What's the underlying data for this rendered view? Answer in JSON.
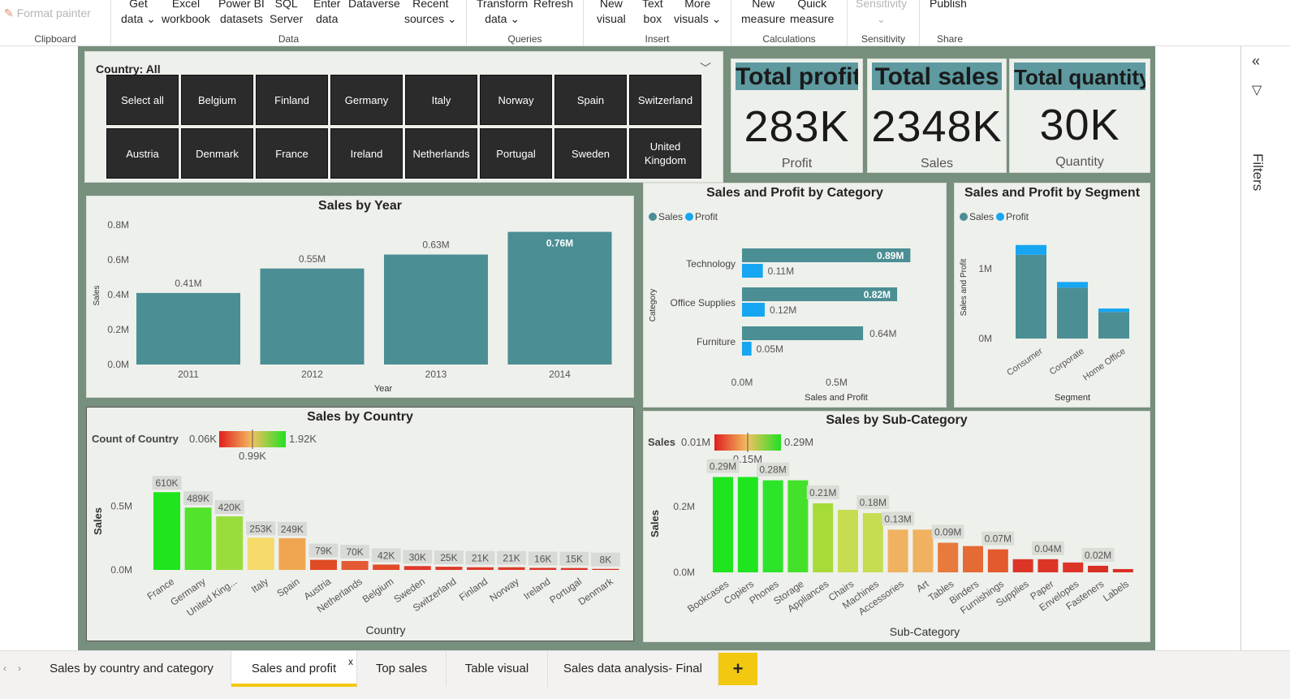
{
  "ribbon": {
    "format_painter": "Format painter",
    "groups": {
      "clipboard": "Clipboard",
      "data": "Data",
      "queries": "Queries",
      "insert": "Insert",
      "calculations": "Calculations",
      "sensitivity": "Sensitivity",
      "share": "Share"
    },
    "buttons": {
      "get_data_1": "Get",
      "get_data_2": "data",
      "excel_1": "Excel",
      "excel_2": "workbook",
      "pbi_1": "Power BI",
      "pbi_2": "datasets",
      "sql_1": "SQL",
      "sql_2": "Server",
      "enter_1": "Enter",
      "enter_2": "data",
      "dataverse_1": "Dataverse",
      "recent_1": "Recent",
      "recent_2": "sources",
      "transform_1": "Transform",
      "transform_2": "data",
      "refresh_1": "Refresh",
      "new_visual_1": "New",
      "new_visual_2": "visual",
      "text_box_1": "Text",
      "text_box_2": "box",
      "more_visuals_1": "More",
      "more_visuals_2": "visuals",
      "new_measure_1": "New",
      "new_measure_2": "measure",
      "quick_measure_1": "Quick",
      "quick_measure_2": "measure",
      "sensitivity_1": "Sensitivity",
      "publish_1": "Publish"
    }
  },
  "slicer": {
    "header": "Country: All",
    "buttons": [
      "Select all",
      "Belgium",
      "Finland",
      "Germany",
      "Italy",
      "Norway",
      "Spain",
      "Switzerland",
      "Austria",
      "Denmark",
      "France",
      "Ireland",
      "Netherlands",
      "Portugal",
      "Sweden",
      "United Kingdom"
    ]
  },
  "cards": [
    {
      "title": "Total profit",
      "value": "283K",
      "label": "Profit"
    },
    {
      "title": "Total sales",
      "value": "2348K",
      "label": "Sales"
    },
    {
      "title": "Total quantity",
      "value": "30K",
      "label": "Quantity"
    }
  ],
  "colors": {
    "teal": "#4b8e94",
    "profit_blue": "#16a6f2",
    "report_bg": "#778f7d",
    "panel_bg": "#eef0ec",
    "accent": "#f2c811"
  },
  "charts": {
    "sales_by_year": {
      "title": "Sales by Year",
      "chart_data": {
        "type": "bar",
        "categories": [
          "2011",
          "2012",
          "2013",
          "2014"
        ],
        "values": [
          0.41,
          0.55,
          0.63,
          0.76
        ],
        "data_labels": [
          "0.41M",
          "0.55M",
          "0.63M",
          "0.76M"
        ],
        "yticks": [
          "0.0M",
          "0.2M",
          "0.4M",
          "0.6M",
          "0.8M"
        ],
        "ylim": [
          0,
          0.8
        ],
        "xlabel": "Year",
        "ylabel": "Sales"
      }
    },
    "sales_profit_category": {
      "title": "Sales and Profit by Category",
      "legend": [
        "Sales",
        "Profit"
      ],
      "chart_data": {
        "type": "bar",
        "orientation": "horizontal",
        "categories": [
          "Technology",
          "Office Supplies",
          "Furniture"
        ],
        "series": [
          {
            "name": "Sales",
            "values": [
              0.89,
              0.82,
              0.64
            ],
            "labels": [
              "0.89M",
              "0.82M",
              "0.64M"
            ]
          },
          {
            "name": "Profit",
            "values": [
              0.11,
              0.12,
              0.05
            ],
            "labels": [
              "0.11M",
              "0.12M",
              "0.05M"
            ]
          }
        ],
        "xticks": [
          "0.0M",
          "0.5M"
        ],
        "xlim": [
          0,
          1.0
        ],
        "xlabel": "Sales and Profit",
        "ylabel": "Category"
      }
    },
    "sales_profit_segment": {
      "title": "Sales and Profit by Segment",
      "legend": [
        "Sales",
        "Profit"
      ],
      "chart_data": {
        "type": "bar",
        "stacked": true,
        "categories": [
          "Consumer",
          "Corporate",
          "Home Office"
        ],
        "series": [
          {
            "name": "Sales",
            "values": [
              1.2,
              0.73,
              0.38
            ]
          },
          {
            "name": "Profit",
            "values": [
              0.14,
              0.08,
              0.05
            ]
          }
        ],
        "yticks": [
          "0M",
          "1M"
        ],
        "ylim": [
          0,
          1.6
        ],
        "xlabel": "Segment",
        "ylabel": "Sales and Profit"
      }
    },
    "sales_by_country": {
      "title": "Sales by Country",
      "legend_title": "Count of Country",
      "legend_min": "0.06K",
      "legend_mid": "0.99K",
      "legend_max": "1.92K",
      "chart_data": {
        "type": "bar",
        "categories": [
          "France",
          "Germany",
          "United King...",
          "Italy",
          "Spain",
          "Austria",
          "Netherlands",
          "Belgium",
          "Sweden",
          "Switzerland",
          "Finland",
          "Norway",
          "Ireland",
          "Portugal",
          "Denmark"
        ],
        "values": [
          610,
          489,
          420,
          253,
          249,
          79,
          70,
          42,
          30,
          25,
          21,
          21,
          16,
          15,
          8
        ],
        "data_labels": [
          "610K",
          "489K",
          "420K",
          "253K",
          "249K",
          "79K",
          "70K",
          "42K",
          "30K",
          "25K",
          "21K",
          "21K",
          "16K",
          "15K",
          "8K"
        ],
        "bar_colors": [
          "#1ee51e",
          "#52e32c",
          "#99dd3c",
          "#f6da6a",
          "#f0a650",
          "#e04a24",
          "#e35a34",
          "#e24a28",
          "#e0392a",
          "#dd3a28",
          "#de3a2a",
          "#de3a2a",
          "#dd3528",
          "#dd3528",
          "#d93025"
        ],
        "yticks": [
          "0.0M",
          "0.5M"
        ],
        "ylim": [
          0,
          700
        ],
        "xlabel": "Country",
        "ylabel": "Sales"
      }
    },
    "sales_by_subcategory": {
      "title": "Sales by Sub-Category",
      "legend_title": "Sales",
      "legend_min": "0.01M",
      "legend_mid": "0.15M",
      "legend_max": "0.29M",
      "chart_data": {
        "type": "bar",
        "categories": [
          "Bookcases",
          "Copiers",
          "Phones",
          "Storage",
          "Appliances",
          "Chairs",
          "Machines",
          "Accessories",
          "Art",
          "Tables",
          "Binders",
          "Furnishings",
          "Supplies",
          "Paper",
          "Envelopes",
          "Fasteners",
          "Labels"
        ],
        "values": [
          0.29,
          0.29,
          0.28,
          0.28,
          0.21,
          0.19,
          0.18,
          0.13,
          0.13,
          0.09,
          0.08,
          0.07,
          0.04,
          0.04,
          0.03,
          0.02,
          0.01
        ],
        "data_labels": [
          "0.29M",
          "",
          "0.28M",
          "",
          "0.21M",
          "",
          "0.18M",
          "0.13M",
          "",
          "0.09M",
          "",
          "0.07M",
          "",
          "0.04M",
          "",
          "0.02M",
          ""
        ],
        "bar_colors": [
          "#1ee51e",
          "#1fe51f",
          "#2ce52a",
          "#44e12a",
          "#a6db38",
          "#c6dd52",
          "#c6dd52",
          "#f0b260",
          "#f0b260",
          "#e77a3c",
          "#e46b34",
          "#e35a2c",
          "#dc3528",
          "#dc3528",
          "#dc3528",
          "#d93025",
          "#d93025"
        ],
        "yticks": [
          "0.0M",
          "0.2M"
        ],
        "ylim": [
          0,
          0.3
        ],
        "xlabel": "Sub-Category",
        "ylabel": "Sales"
      }
    }
  },
  "filters": {
    "label": "Filters"
  },
  "tabs": [
    {
      "label": "Sales by country and category"
    },
    {
      "label": "Sales and profit",
      "close": "x"
    },
    {
      "label": "Top sales"
    },
    {
      "label": "Table visual"
    },
    {
      "label": "Sales data analysis- Final"
    }
  ],
  "tab_add": "+"
}
